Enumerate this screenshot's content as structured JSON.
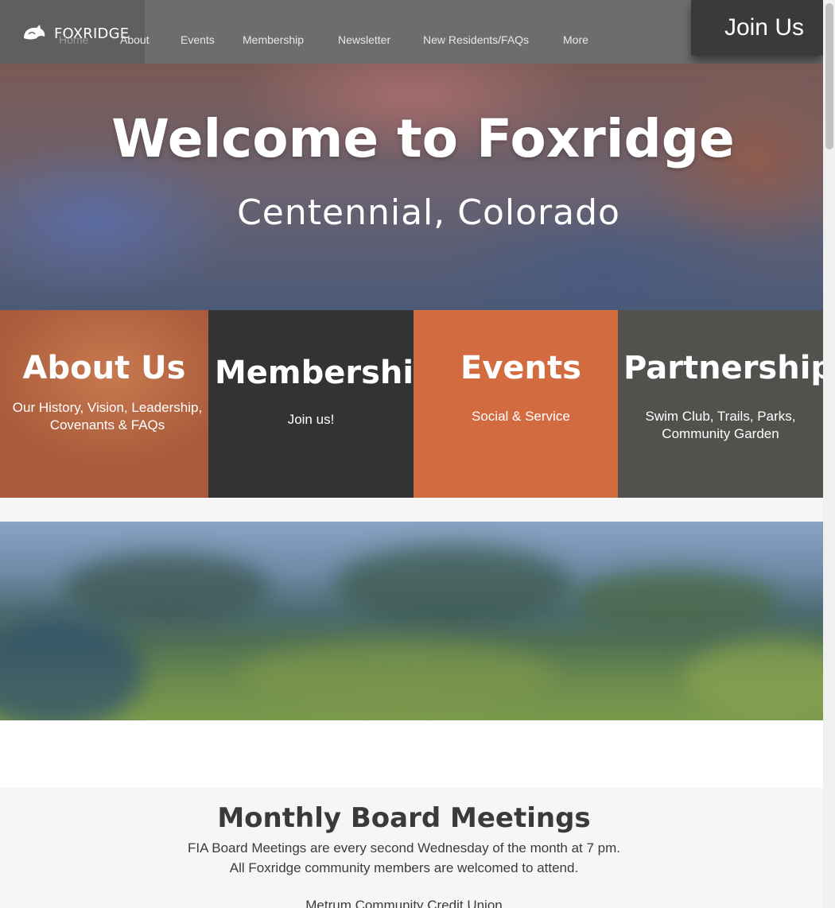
{
  "brand": {
    "name": "FOXRIDGE",
    "logo_icon": "fox-icon"
  },
  "nav": {
    "items": [
      {
        "label": "Home"
      },
      {
        "label": "About"
      },
      {
        "label": "Events"
      },
      {
        "label": "Membership"
      },
      {
        "label": "Newsletter"
      },
      {
        "label": "New Residents/FAQs"
      },
      {
        "label": "More"
      }
    ],
    "join_label": "Join Us"
  },
  "hero": {
    "title": "Welcome to Foxridge",
    "subtitle": "Centennial, Colorado"
  },
  "tiles": [
    {
      "title": "About Us",
      "subtitle": "Our History, Vision, Leadership, Covenants & FAQs"
    },
    {
      "title": "Membership",
      "subtitle": "Join us!"
    },
    {
      "title": "Events",
      "subtitle": "Social & Service"
    },
    {
      "title": "Partnerships",
      "subtitle": "Swim Club, Trails, Parks, Community Garden"
    }
  ],
  "meetings": {
    "title": "Monthly Board Meetings",
    "line1": "FIA Board Meetings are every second Wednesday of the month at 7 pm.",
    "line2": "All Foxridge community members are welcomed to attend.",
    "line3": "Metrum Community Credit Union"
  },
  "colors": {
    "header_bg": "#6d6d6d",
    "join_bg": "#3a3a3a",
    "tile_about": "#b8653f",
    "tile_membership": "#333333",
    "tile_events": "#d36b40",
    "tile_partnerships": "#51514e"
  }
}
